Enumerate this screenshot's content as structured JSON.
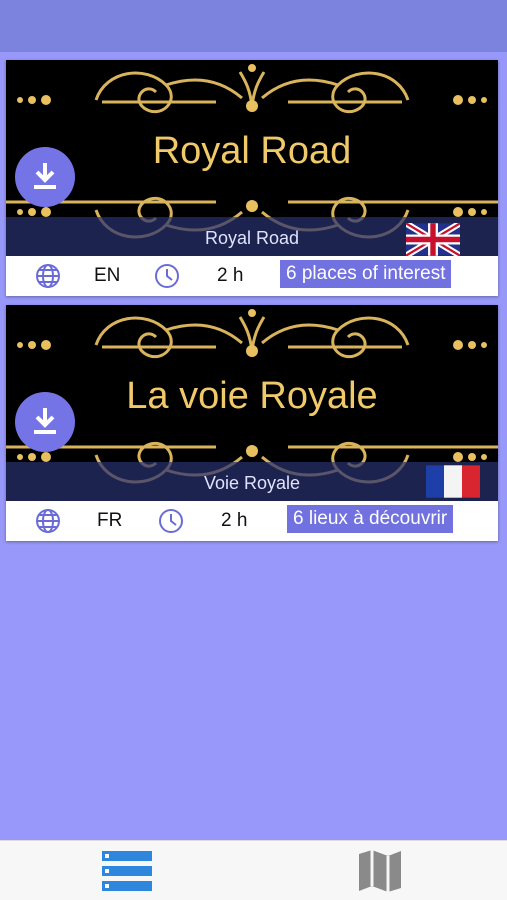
{
  "colors": {
    "background": "#9898fa",
    "top_bar": "#7b83df",
    "accent": "#7171e0",
    "gold": "#f0c96a",
    "tab_active": "#2f86dd",
    "tab_inactive": "#8a8a8a"
  },
  "tours": [
    {
      "banner_title": "Royal Road",
      "subtitle": "Royal Road",
      "flag_icon": "uk-flag-icon",
      "language": "EN",
      "duration": "2 h",
      "places": "6 places of interest"
    },
    {
      "banner_title": "La voie Royale",
      "subtitle": "Voie Royale",
      "flag_icon": "france-flag-icon",
      "language": "FR",
      "duration": "2 h",
      "places": "6 lieux à découvrir"
    }
  ],
  "tab_bar": {
    "items": [
      {
        "icon": "list-icon",
        "active": true
      },
      {
        "icon": "map-icon",
        "active": false
      }
    ]
  }
}
